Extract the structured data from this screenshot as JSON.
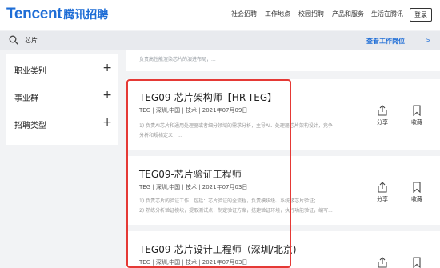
{
  "header": {
    "logo_en": "Tencent",
    "logo_cn": "腾讯招聘",
    "nav": [
      "社会招聘",
      "工作地点",
      "校园招聘",
      "产品和服务",
      "生活在腾讯"
    ],
    "login_label": "登录",
    "brand_color": "#1e6dd6"
  },
  "search": {
    "value": "芯片",
    "link_label": "查看工作岗位",
    "link_chevron": ">"
  },
  "sidebar": {
    "filters": [
      {
        "label": "职业类别",
        "icon": "+"
      },
      {
        "label": "事业群",
        "icon": "+"
      },
      {
        "label": "招聘类型",
        "icon": "+"
      }
    ]
  },
  "jobs": {
    "fragment_text": "负责高性能渲染芯片的演进布局；...",
    "actions": {
      "share": "分享",
      "collect": "收藏"
    },
    "items": [
      {
        "title": "TEG09-芯片架构师【HR-TEG】",
        "meta": "TEG | 深圳,中国 | 技术 | 2021年07月09日",
        "desc": [
          "1) 负责AI芯片和通用处理器或者细分领域的需求分析，主导AI、处理器芯片架构设计，竞争",
          "分析和规格定义；..."
        ]
      },
      {
        "title": "TEG09-芯片验证工程师",
        "meta": "TEG | 深圳,中国 | 技术 | 2021年07月03日",
        "desc": [
          "1) 负责芯片的验证工作，包括：芯片验证的全流程，负责模块级、系统级芯片验证；",
          "2) 熟练分析验证模块，提取测试点，制定验证方案，搭建验证环境，执行功能验证，编写..."
        ]
      },
      {
        "title": "TEG09-芯片设计工程师（深圳/北京)",
        "meta": "TEG | 深圳,中国 | 技术 | 2021年07月03日",
        "desc": []
      }
    ]
  },
  "highlight_color": "#e53935"
}
